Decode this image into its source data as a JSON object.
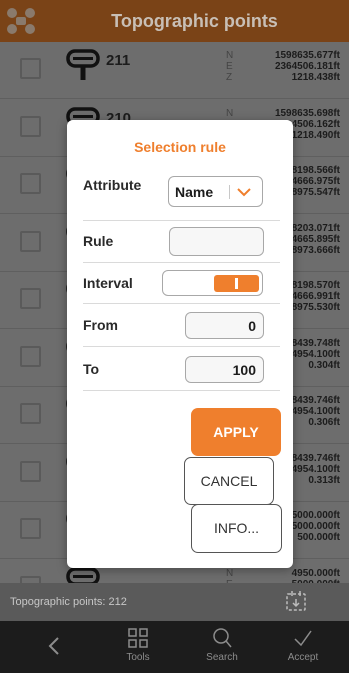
{
  "header": {
    "title": "Topographic points",
    "logo_icon": "app-logo-icon"
  },
  "points": [
    {
      "name": "211",
      "axes": [
        "N",
        "E",
        "Z"
      ],
      "values": [
        "1598635.677ft",
        "2364506.181ft",
        "1218.438ft"
      ]
    },
    {
      "name": "210",
      "axes": [
        "N",
        "E",
        "Z"
      ],
      "values": [
        "1598635.698ft",
        "2364506.162ft",
        "1218.490ft"
      ]
    },
    {
      "name": "",
      "axes": [
        "N",
        "E",
        "Z"
      ],
      "values": [
        "1598198.566ft",
        "2364666.975ft",
        "1218975.547ft"
      ]
    },
    {
      "name": "",
      "axes": [
        "N",
        "E",
        "Z"
      ],
      "values": [
        "1598203.071ft",
        "2364665.895ft",
        "1218973.666ft"
      ]
    },
    {
      "name": "",
      "axes": [
        "N",
        "E",
        "Z"
      ],
      "values": [
        "1598198.570ft",
        "2364666.991ft",
        "1218975.530ft"
      ]
    },
    {
      "name": "",
      "axes": [
        "N",
        "E",
        "Z"
      ],
      "values": [
        "1598439.748ft",
        "2364954.100ft",
        "0.304ft"
      ]
    },
    {
      "name": "",
      "axes": [
        "N",
        "E",
        "Z"
      ],
      "values": [
        "1598439.746ft",
        "2364954.100ft",
        "0.306ft"
      ]
    },
    {
      "name": "",
      "axes": [
        "N",
        "E",
        "Z"
      ],
      "values": [
        "1598439.746ft",
        "2364954.100ft",
        "0.313ft"
      ]
    },
    {
      "name": "",
      "axes": [
        "N",
        "E",
        "Z"
      ],
      "values": [
        "5000.000ft",
        "5000.000ft",
        "500.000ft"
      ]
    },
    {
      "name": "",
      "axes": [
        "N",
        "E",
        "Z"
      ],
      "values": [
        "4950.000ft",
        "5000.000ft",
        "500.000ft"
      ]
    }
  ],
  "status": {
    "text": "Topographic points: 212",
    "icon": "calendar-arrow-icon"
  },
  "bottom_bar": [
    {
      "label": "",
      "icon": "back-chevron-icon"
    },
    {
      "label": "Tools",
      "icon": "grid-icon"
    },
    {
      "label": "Search",
      "icon": "search-icon"
    },
    {
      "label": "Accept",
      "icon": "check-icon"
    }
  ],
  "dialog": {
    "title": "Selection rule",
    "attribute_label": "Attribute",
    "attribute_value": "Name",
    "rule_label": "Rule",
    "rule_value": "",
    "interval_label": "Interval",
    "interval_on": true,
    "from_label": "From",
    "from_value": "0",
    "to_label": "To",
    "to_value": "100",
    "apply_label": "APPLY",
    "cancel_label": "CANCEL",
    "info_label": "INFO..."
  },
  "colors": {
    "accent": "#ef7f2d",
    "header": "#7a4317"
  }
}
